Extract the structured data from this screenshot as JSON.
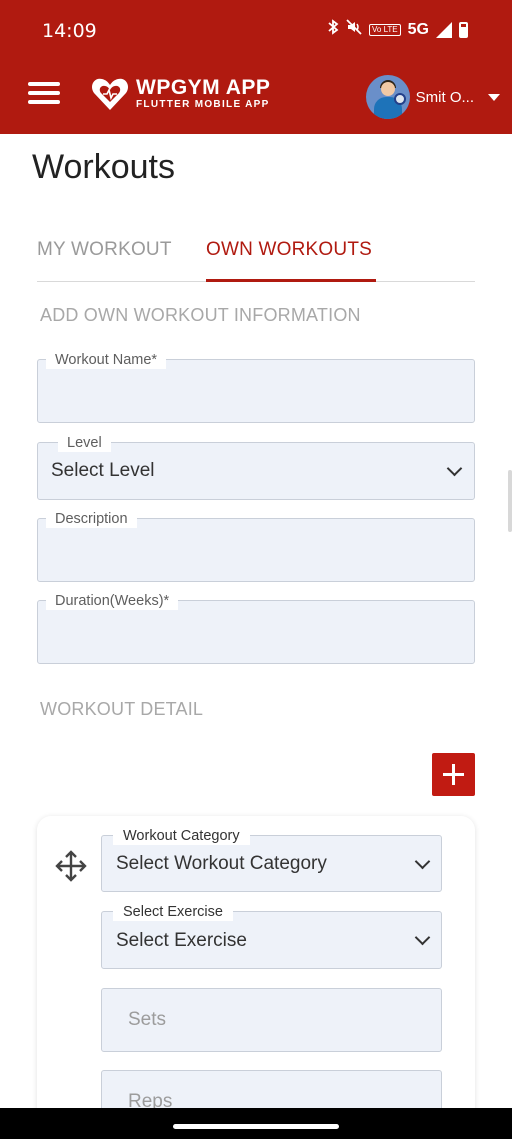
{
  "status_bar": {
    "time": "14:09",
    "icons": [
      "bluetooth-icon",
      "mute-icon",
      "volte-icon",
      "signal-icon",
      "battery-icon"
    ],
    "volte": "Vo\nLTE",
    "network": "5G"
  },
  "app_bar": {
    "brand": "WPGYM APP",
    "subtitle": "FLUTTER MOBILE APP",
    "user_name": "Smit O...",
    "colors": {
      "primary": "#b01a10"
    }
  },
  "page": {
    "title": "Workouts",
    "tabs": [
      {
        "label": "MY WORKOUT",
        "active": false
      },
      {
        "label": "OWN WORKOUTS",
        "active": true
      }
    ],
    "info_section_title": "ADD OWN WORKOUT INFORMATION",
    "fields": {
      "workout_name": {
        "label": "Workout Name*",
        "value": ""
      },
      "level": {
        "label": "Level",
        "value": "Select Level"
      },
      "description": {
        "label": "Description",
        "value": ""
      },
      "duration": {
        "label": "Duration(Weeks)*",
        "value": ""
      }
    },
    "detail_section_title": "WORKOUT DETAIL",
    "detail_card": {
      "category": {
        "label": "Workout Category",
        "value": "Select Workout Category"
      },
      "exercise": {
        "label": "Select Exercise",
        "value": "Select Exercise"
      },
      "sets_placeholder": "Sets",
      "reps_placeholder": "Reps"
    }
  }
}
